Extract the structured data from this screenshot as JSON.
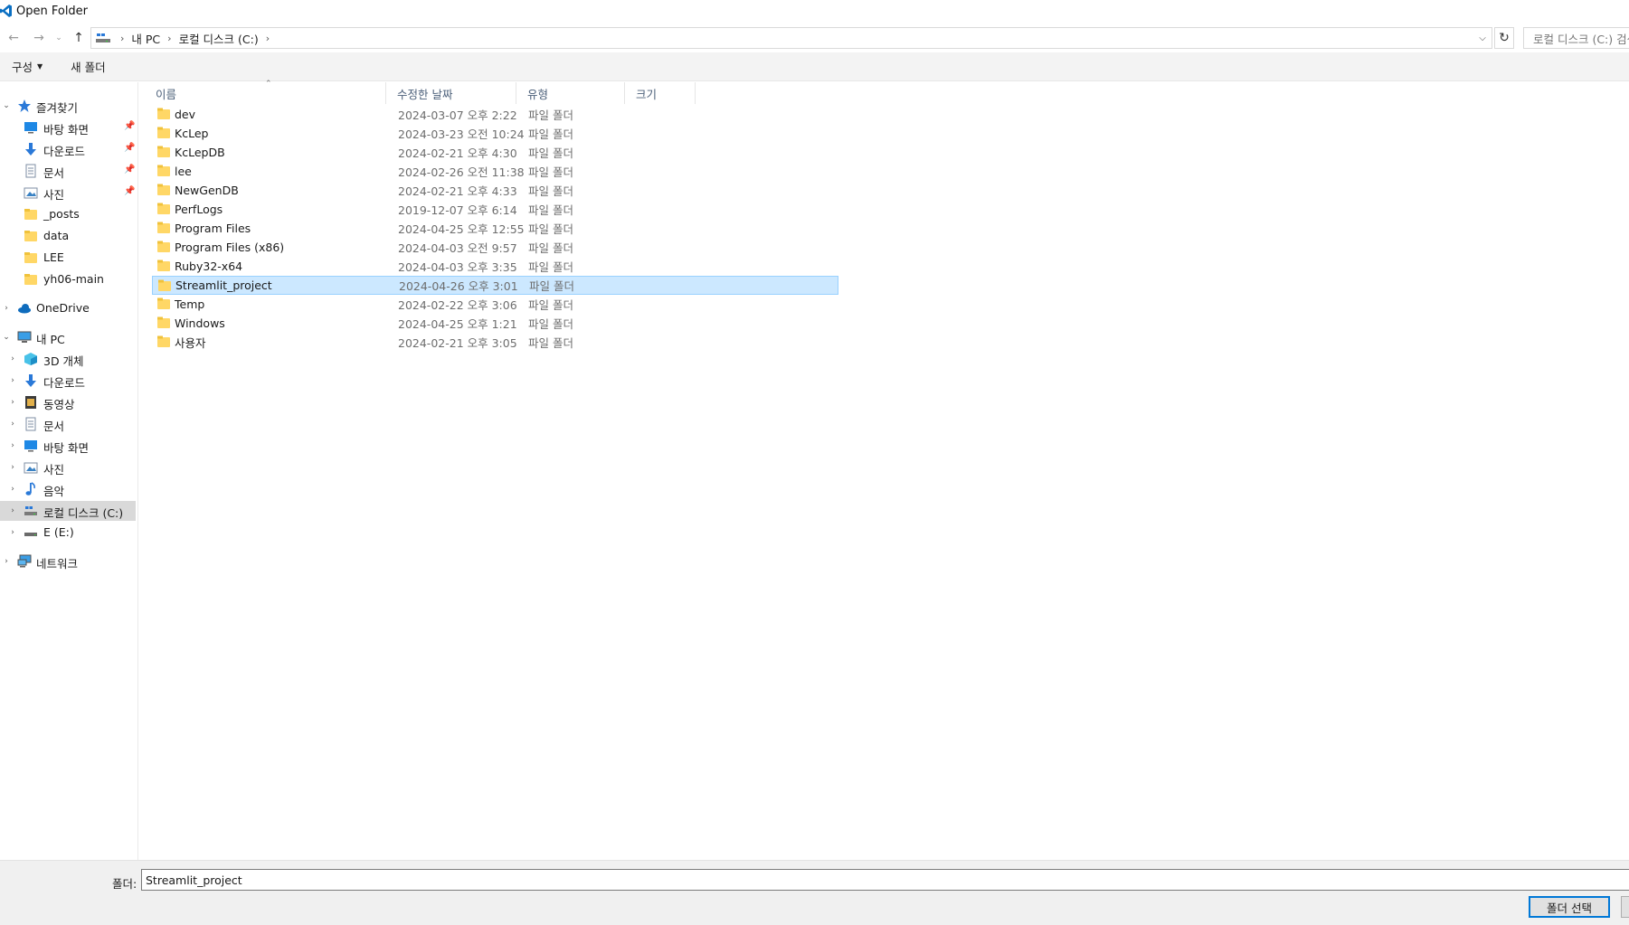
{
  "window": {
    "title": "Open Folder"
  },
  "address": {
    "crumbs": [
      "내 PC",
      "로컬 디스크 (C:)"
    ],
    "search_placeholder": "로컬 디스크 (C:) 검색"
  },
  "toolbar": {
    "organize_label": "구성",
    "new_folder_label": "새 폴더"
  },
  "sidebar": {
    "quick_access": {
      "label": "즐겨찾기",
      "items": [
        {
          "label": "바탕 화면",
          "icon": "desktop-icon",
          "pinned": true
        },
        {
          "label": "다운로드",
          "icon": "download-icon",
          "pinned": true
        },
        {
          "label": "문서",
          "icon": "document-icon",
          "pinned": true
        },
        {
          "label": "사진",
          "icon": "pictures-icon",
          "pinned": true
        },
        {
          "label": "_posts",
          "icon": "folder-icon",
          "pinned": false
        },
        {
          "label": "data",
          "icon": "folder-icon",
          "pinned": false
        },
        {
          "label": "LEE",
          "icon": "folder-icon",
          "pinned": false
        },
        {
          "label": "yh06-main",
          "icon": "folder-icon",
          "pinned": false
        }
      ]
    },
    "onedrive": {
      "label": "OneDrive"
    },
    "this_pc": {
      "label": "내 PC",
      "items": [
        {
          "label": "3D 개체",
          "icon": "3d-objects-icon"
        },
        {
          "label": "다운로드",
          "icon": "download-icon"
        },
        {
          "label": "동영상",
          "icon": "video-icon"
        },
        {
          "label": "문서",
          "icon": "document-icon"
        },
        {
          "label": "바탕 화면",
          "icon": "desktop-icon"
        },
        {
          "label": "사진",
          "icon": "pictures-icon"
        },
        {
          "label": "음악",
          "icon": "music-icon"
        },
        {
          "label": "로컬 디스크 (C:)",
          "icon": "local-disk-icon",
          "selected": true
        },
        {
          "label": "E (E:)",
          "icon": "drive-icon"
        }
      ]
    },
    "network": {
      "label": "네트워크"
    }
  },
  "columns": {
    "name": "이름",
    "modified": "수정한 날짜",
    "type": "유형",
    "size": "크기"
  },
  "files": [
    {
      "name": "dev",
      "modified": "2024-03-07 오후 2:22",
      "type": "파일 폴더"
    },
    {
      "name": "KcLep",
      "modified": "2024-03-23 오전 10:24",
      "type": "파일 폴더"
    },
    {
      "name": "KcLepDB",
      "modified": "2024-02-21 오후 4:30",
      "type": "파일 폴더"
    },
    {
      "name": "lee",
      "modified": "2024-02-26 오전 11:38",
      "type": "파일 폴더"
    },
    {
      "name": "NewGenDB",
      "modified": "2024-02-21 오후 4:33",
      "type": "파일 폴더"
    },
    {
      "name": "PerfLogs",
      "modified": "2019-12-07 오후 6:14",
      "type": "파일 폴더"
    },
    {
      "name": "Program Files",
      "modified": "2024-04-25 오후 12:55",
      "type": "파일 폴더"
    },
    {
      "name": "Program Files (x86)",
      "modified": "2024-04-03 오전 9:57",
      "type": "파일 폴더"
    },
    {
      "name": "Ruby32-x64",
      "modified": "2024-04-03 오후 3:35",
      "type": "파일 폴더"
    },
    {
      "name": "Streamlit_project",
      "modified": "2024-04-26 오후 3:01",
      "type": "파일 폴더",
      "selected": true
    },
    {
      "name": "Temp",
      "modified": "2024-02-22 오후 3:06",
      "type": "파일 폴더"
    },
    {
      "name": "Windows",
      "modified": "2024-04-25 오후 1:21",
      "type": "파일 폴더"
    },
    {
      "name": "사용자",
      "modified": "2024-02-21 오후 3:05",
      "type": "파일 폴더"
    }
  ],
  "footer": {
    "folder_label": "폴더:",
    "folder_value": "Streamlit_project",
    "select_button": "폴더 선택"
  },
  "colors": {
    "selection": "#cce8ff",
    "selection_border": "#99d1ff",
    "accent": "#0078d7",
    "folder": "#ffd766"
  }
}
